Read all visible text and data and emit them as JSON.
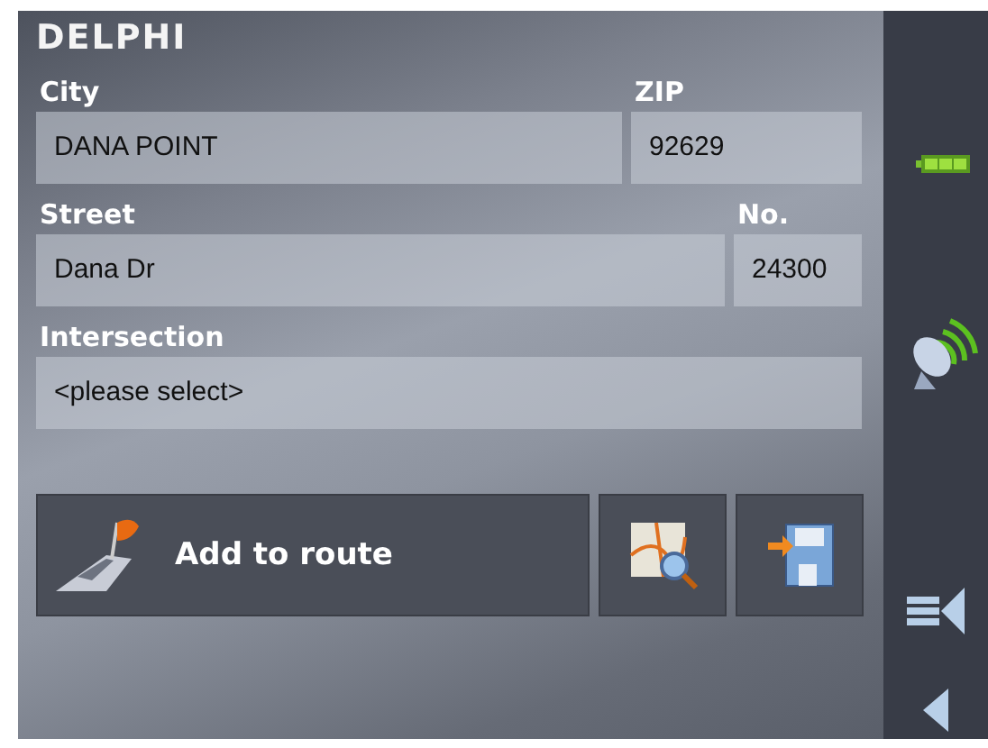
{
  "logo": "DELPHI",
  "rows": [
    {
      "fields": [
        {
          "label": "City",
          "value": "DANA POINT"
        },
        {
          "label": "ZIP",
          "value": "92629"
        }
      ]
    },
    {
      "fields": [
        {
          "label": "Street",
          "value": "Dana Dr"
        },
        {
          "label": "No.",
          "value": "24300"
        }
      ]
    },
    {
      "fields": [
        {
          "label": "Intersection",
          "value": "<please select>"
        }
      ]
    }
  ],
  "actions": [
    {
      "kind": "route",
      "label": "Add to route"
    },
    {
      "kind": "map"
    },
    {
      "kind": "save"
    }
  ],
  "sidebar": [
    {
      "kind": "battery"
    },
    {
      "kind": "satellite"
    },
    {
      "kind": "menu"
    },
    {
      "kind": "back"
    }
  ]
}
